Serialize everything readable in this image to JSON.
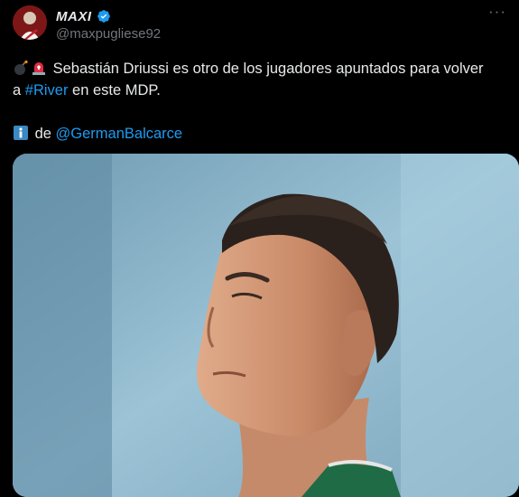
{
  "author": {
    "display_name": "MAXI",
    "handle": "@maxpugliese92",
    "verified": true
  },
  "tweet": {
    "line1_text": " Sebastián Driussi es otro de los jugadores apuntados para volver",
    "line2_prefix": "a ",
    "line2_hashtag": "#River",
    "line2_suffix": " en este MDP.",
    "line3_prefix": " de ",
    "line3_mention": "@GermanBalcarce",
    "emojis": [
      "bomb-icon",
      "siren-icon",
      "info-icon"
    ]
  },
  "colors": {
    "background": "#000000",
    "text": "#e7e9ea",
    "secondary": "#71767b",
    "link": "#1d9bf0",
    "verified": "#1d9bf0"
  }
}
